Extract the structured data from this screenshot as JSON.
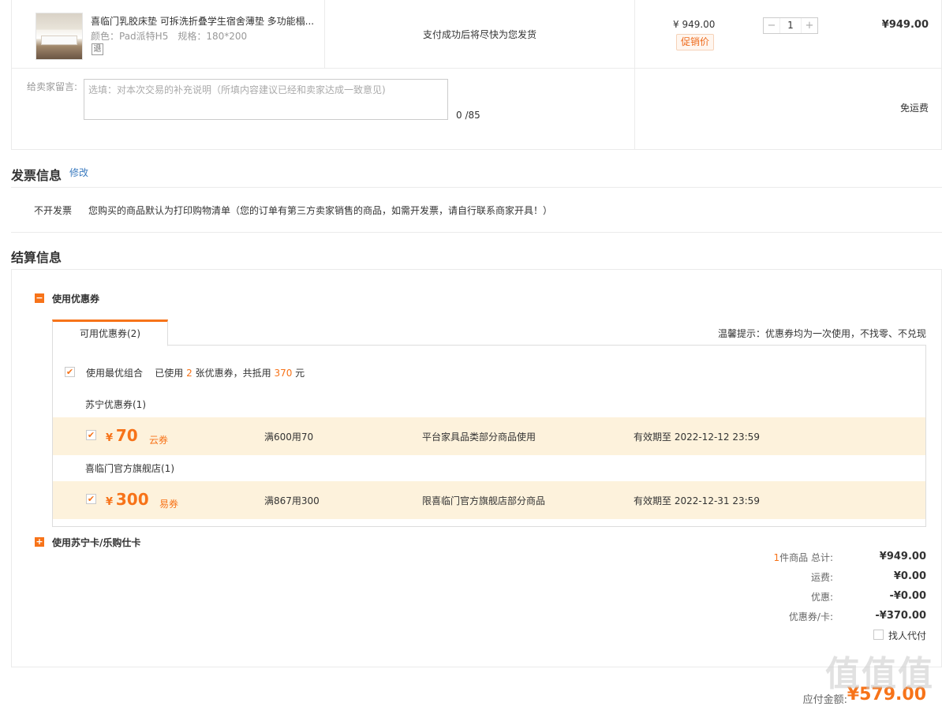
{
  "product": {
    "name": "喜临门乳胶床垫 可拆洗折叠学生宿舍薄垫 多功能榻...",
    "color_label": "颜色：Pad派特H5",
    "size_label": "规格：180*200",
    "return_badge": "退",
    "shipping_note": "支付成功后将尽快为您发货",
    "unit_price": "¥ 949.00",
    "promo_badge": "促销价",
    "qty_minus": "−",
    "qty_value": "1",
    "qty_plus": "+",
    "subtotal": "¥949.00"
  },
  "message": {
    "label": "给卖家留言:",
    "placeholder": "选填：对本次交易的补充说明（所填内容建议已经和卖家达成一致意见)",
    "counter": "0 /85",
    "shipping_fee": "免运费"
  },
  "invoice": {
    "title": "发票信息",
    "modify": "修改",
    "type": "不开发票",
    "description": "您购买的商品默认为打印购物清单（您的订单有第三方卖家销售的商品，如需开发票，请自行联系商家开具！）"
  },
  "settlement": {
    "title": "结算信息",
    "coupon_toggle_icon": "−",
    "coupon_section": "使用优惠券",
    "tab_available": "可用优惠券(2)",
    "tip": "温馨提示：优惠券均为一次使用，不找零、不兑现",
    "best_combo": "使用最优组合",
    "used_prefix": "已使用",
    "used_count": "2",
    "used_mid": "张优惠券，共抵用",
    "used_amount": "370",
    "used_suffix": "元",
    "groups": [
      {
        "label": "苏宁优惠券(1)",
        "yen": "¥",
        "amount": "70",
        "type": "云券",
        "threshold": "满600用70",
        "scope": "平台家具品类部分商品使用",
        "validity": "有效期至 2022-12-12 23:59"
      },
      {
        "label": "喜临门官方旗舰店(1)",
        "yen": "¥",
        "amount": "300",
        "type": "易券",
        "threshold": "满867用300",
        "scope": "限喜临门官方旗舰店部分商品",
        "validity": "有效期至 2022-12-31 23:59"
      }
    ],
    "card_toggle_icon": "+",
    "card_section": "使用苏宁卡/乐购仕卡"
  },
  "totals": {
    "items_count": "1",
    "items_label": "件商品 总计:",
    "items_total": "¥949.00",
    "shipping_label": "运费:",
    "shipping_value": "¥0.00",
    "discount_label": "优惠:",
    "discount_value": "-¥0.00",
    "coupon_label": "优惠券/卡:",
    "coupon_value": "-¥370.00",
    "proxy_pay": "找人代付",
    "pay_label": "应付金额:",
    "pay_amount": "¥579.00"
  },
  "watermark": "值值值",
  "colors": {
    "accent": "#f77319",
    "coupon_bg": "#fdf2dc",
    "link": "#3b7bbf"
  }
}
